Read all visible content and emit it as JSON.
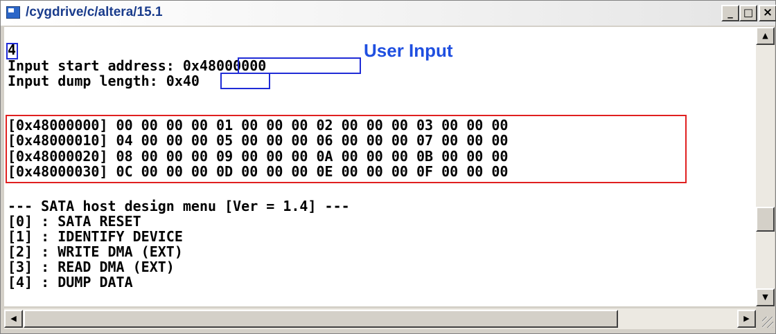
{
  "window": {
    "title": "/cygdrive/c/altera/15.1",
    "controls": {
      "minimize": "_",
      "maximize": "□",
      "close": "×"
    }
  },
  "console": {
    "lines": [
      "4",
      "Input start address: 0x48000000",
      "Input dump length: 0x40",
      "",
      "[0x48000000] 00 00 00 00 01 00 00 00 02 00 00 00 03 00 00 00",
      "[0x48000010] 04 00 00 00 05 00 00 00 06 00 00 00 07 00 00 00",
      "[0x48000020] 08 00 00 00 09 00 00 00 0A 00 00 00 0B 00 00 00",
      "[0x48000030] 0C 00 00 00 0D 00 00 00 0E 00 00 00 0F 00 00 00",
      "",
      "--- SATA host design menu [Ver = 1.4] ---",
      "[0] : SATA RESET",
      "[1] : IDENTIFY DEVICE",
      "[2] : WRITE DMA (EXT)",
      "[3] : READ DMA (EXT)",
      "[4] : DUMP DATA"
    ]
  },
  "annotation": {
    "user_input_label": "User Input",
    "label_color": "#1f4fe0",
    "box_color": "#1f2bd6",
    "data_box_color": "#e02020"
  },
  "scrollbar": {
    "up": "▲",
    "down": "▼",
    "left": "◀",
    "right": "▶"
  }
}
